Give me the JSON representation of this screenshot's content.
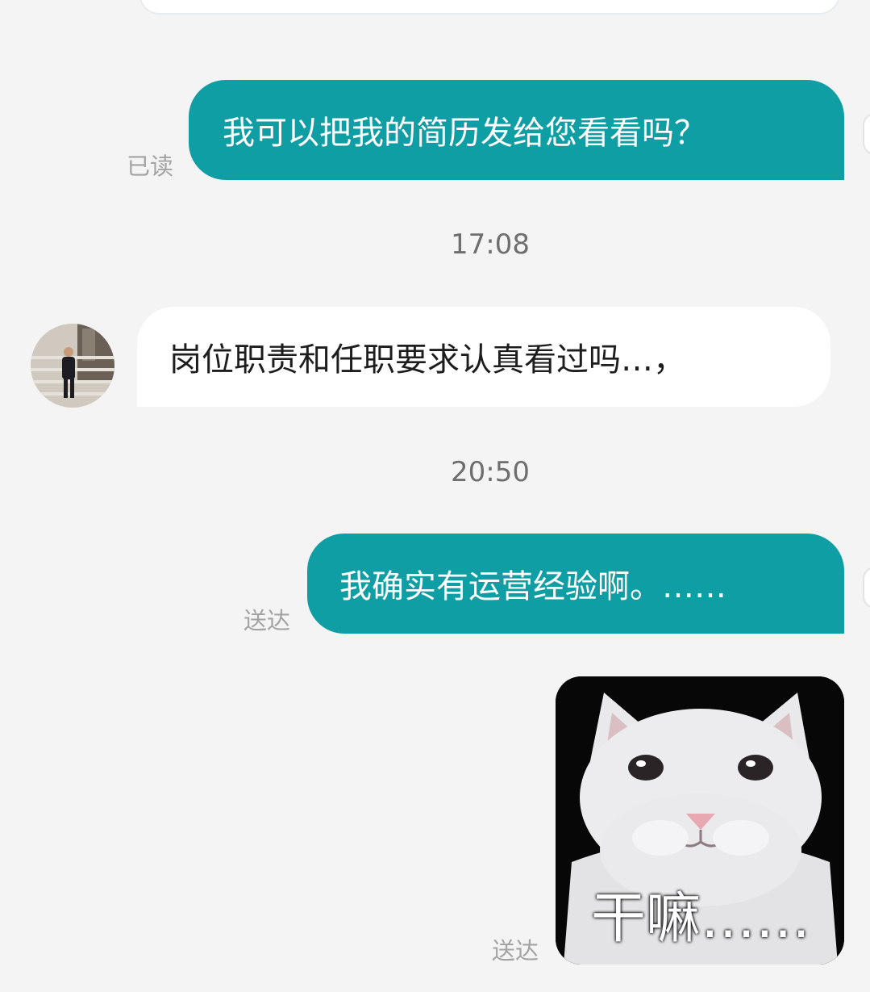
{
  "messages": [
    {
      "text": "我可以把我的简历发给您看看吗？",
      "status": "已读"
    },
    {
      "text": "岗位职责和任职要求认真看过吗…，"
    },
    {
      "text": "我确实有运营经验啊。……",
      "status": "送达"
    },
    {
      "sticker_caption": "干嘛……",
      "status": "送达"
    }
  ],
  "timestamps": [
    "17:08",
    "20:50"
  ],
  "colors": {
    "outgoing_bubble": "#0e9ea4",
    "incoming_bubble": "#ffffff",
    "background": "#f4f4f4"
  }
}
